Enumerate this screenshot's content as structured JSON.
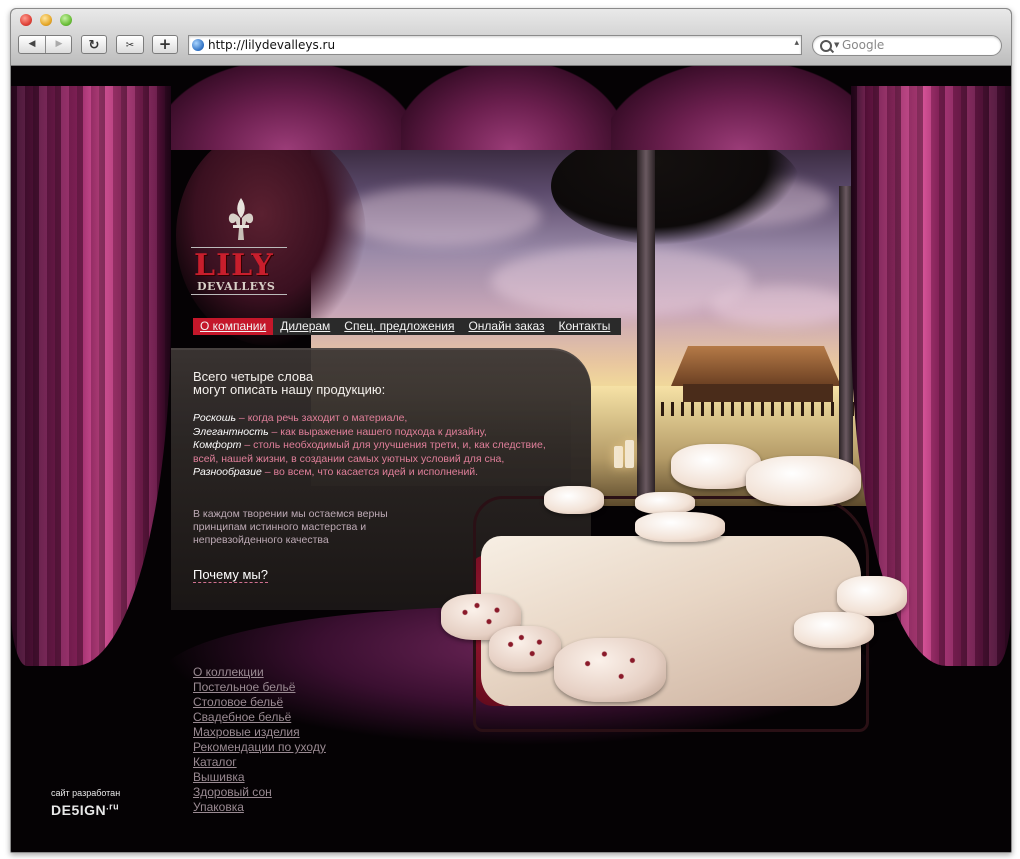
{
  "browser": {
    "url": "http://lilydevalleys.ru",
    "search_placeholder": "Google",
    "back_glyph": "◀",
    "forward_glyph": "▶",
    "reload_glyph": "↻",
    "add_glyph": "+",
    "snippet_glyph": "✂"
  },
  "logo": {
    "name_top": "LILY",
    "name_bottom": "DEVALLEYS"
  },
  "topnav": {
    "items": [
      {
        "label": "О компании"
      },
      {
        "label": "Дилерам"
      },
      {
        "label": "Спец. предложения"
      },
      {
        "label": "Онлайн заказ"
      },
      {
        "label": "Контакты"
      }
    ]
  },
  "content": {
    "headline_line1": "Всего четыре слова",
    "headline_line2": "могут описать нашу продукцию:",
    "features": [
      {
        "term": "Роскошь",
        "text": " – когда речь заходит о материале,"
      },
      {
        "term": "Элегантность",
        "text": " – как выражение нашего подхода к дизайну,"
      },
      {
        "term": "Комфорт",
        "text": " – столь необходимый для улучшения трети, и, как следствие,"
      },
      {
        "term": "",
        "text": "всей, нашей  жизни, в создании самых уютных условий для сна,"
      },
      {
        "term": "Разнообразие",
        "text": " – во всем, что касается идей и исполнений."
      }
    ],
    "motto_line1": "В каждом творении мы остаемся верны",
    "motto_line2": "принципам истинного мастерства и",
    "motto_line3": "непревзойденного качества",
    "why_link": "Почему мы?"
  },
  "bottom_menu": {
    "items": [
      {
        "label": "О коллекции"
      },
      {
        "label": "Постельное бельё"
      },
      {
        "label": "Столовое бельё"
      },
      {
        "label": "Свадебное бельё"
      },
      {
        "label": "Махровые изделия"
      },
      {
        "label": "Рекомендации по уходу"
      },
      {
        "label": "Каталог"
      },
      {
        "label": "Вышивка"
      },
      {
        "label": "Здоровый сон"
      },
      {
        "label": "Упаковка"
      }
    ]
  },
  "credit": {
    "caption": "сайт разработан",
    "brand": "DE5IGN",
    "brand_suffix": ".ru"
  },
  "colors": {
    "accent_red": "#c4172a",
    "curtain_magenta": "#a3296d",
    "feature_pink": "#e07f9a"
  }
}
